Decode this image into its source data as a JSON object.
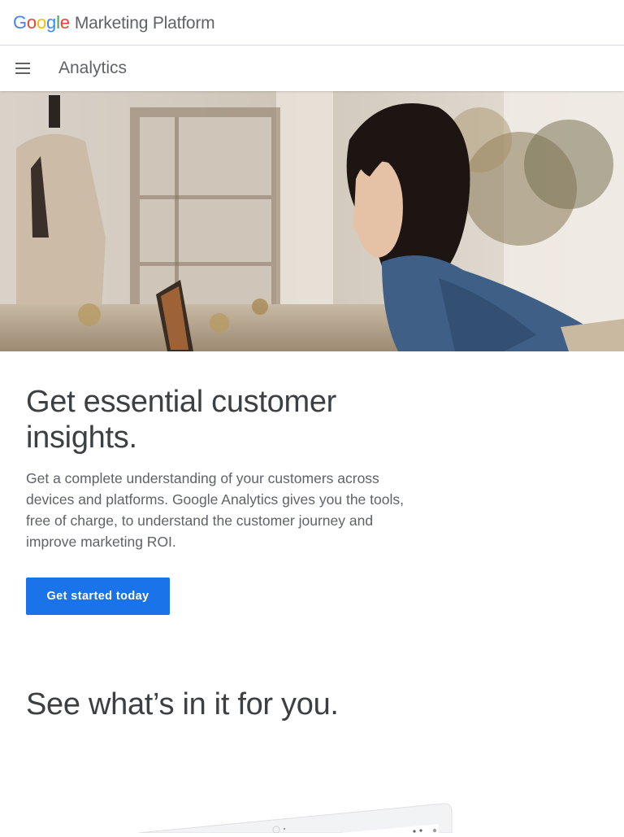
{
  "brand": {
    "logo_letters": [
      "G",
      "o",
      "o",
      "g",
      "l",
      "e"
    ],
    "logo_colors": [
      "#4285F4",
      "#EA4335",
      "#FBBC05",
      "#4285F4",
      "#34A853",
      "#EA4335"
    ],
    "product": "Marketing Platform"
  },
  "nav": {
    "menu_icon": "hamburger-menu-icon",
    "title": "Analytics"
  },
  "hero": {
    "image": "photo: woman in denim shirt working on a laptop in a boutique shop"
  },
  "main": {
    "headline": "Get essential customer insights.",
    "lead": "Get a complete understanding of your customers across devices and platforms. Google Analytics gives you the tools, free of charge, to understand the customer journey and improve marketing ROI.",
    "cta_label": "Get started today",
    "cta_color": "#1a73e8"
  },
  "section": {
    "title": "See what’s in it for you."
  }
}
